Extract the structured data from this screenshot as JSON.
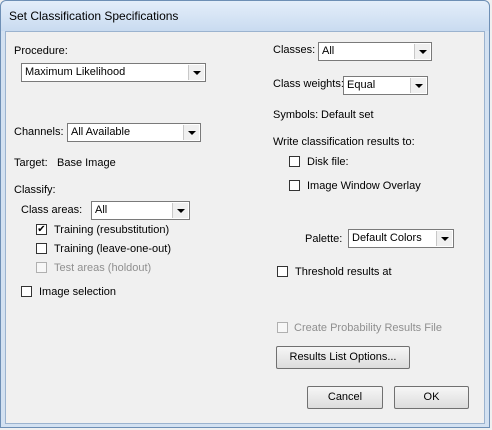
{
  "window": {
    "title": "Set Classification Specifications"
  },
  "procedure": {
    "label": "Procedure:",
    "value": "Maximum Likelihood"
  },
  "channels": {
    "label": "Channels:",
    "value": "All Available"
  },
  "target": {
    "label": "Target:",
    "value": "Base Image"
  },
  "classify": {
    "label": "Classify:",
    "class_areas": {
      "label": "Class areas:",
      "value": "All"
    },
    "training_resub": {
      "label": "Training (resubstitution)",
      "checked": true
    },
    "training_loo": {
      "label": "Training (leave-one-out)",
      "checked": false
    },
    "test_areas": {
      "label": "Test areas (holdout)",
      "checked": false,
      "disabled": true
    },
    "image_selection": {
      "label": "Image selection",
      "checked": false
    }
  },
  "classes": {
    "label": "Classes:",
    "value": "All"
  },
  "class_weights": {
    "label": "Class weights:",
    "value": "Equal"
  },
  "symbols": {
    "label": "Symbols:",
    "value": "Default set"
  },
  "write_results": {
    "label": "Write classification results to:",
    "disk_file": {
      "label": "Disk file:",
      "checked": false
    },
    "image_window_overlay": {
      "label": "Image Window Overlay",
      "checked": false
    }
  },
  "palette": {
    "label": "Palette:",
    "value": "Default Colors"
  },
  "threshold": {
    "label": "Threshold results at",
    "checked": false
  },
  "probability": {
    "label": "Create Probability Results File",
    "checked": false,
    "disabled": true
  },
  "buttons": {
    "results_list": "Results List Options...",
    "cancel": "Cancel",
    "ok": "OK"
  }
}
